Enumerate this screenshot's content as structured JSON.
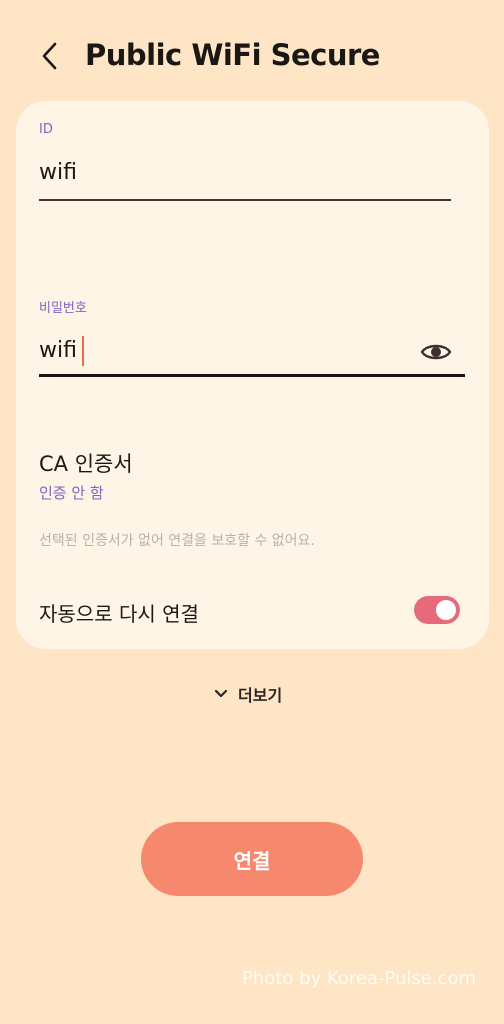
{
  "header": {
    "title": "Public WiFi Secure",
    "back_icon": "chevron-left-icon"
  },
  "form": {
    "id": {
      "label": "ID",
      "value": "wifi"
    },
    "password": {
      "label": "비밀번호",
      "value": "wifi",
      "visibility_icon": "eye-icon"
    },
    "ca_certificate": {
      "title": "CA 인증서",
      "value": "인증 안 함",
      "note": "선택된 인증서가 없어 연결을 보호할 수 없어요."
    },
    "auto_reconnect": {
      "label": "자동으로 다시 연결",
      "enabled": true
    }
  },
  "more": {
    "label": "더보기",
    "icon": "chevron-down-icon"
  },
  "connect_button": {
    "label": "연결"
  },
  "watermark": "Photo by Korea-Pulse.com",
  "colors": {
    "background": "#fde5c6",
    "card": "#fff5e6",
    "accent_label": "#7d63c7",
    "toggle_on": "#e56b7a",
    "button": "#f6896d",
    "cursor": "#f06c4d"
  }
}
